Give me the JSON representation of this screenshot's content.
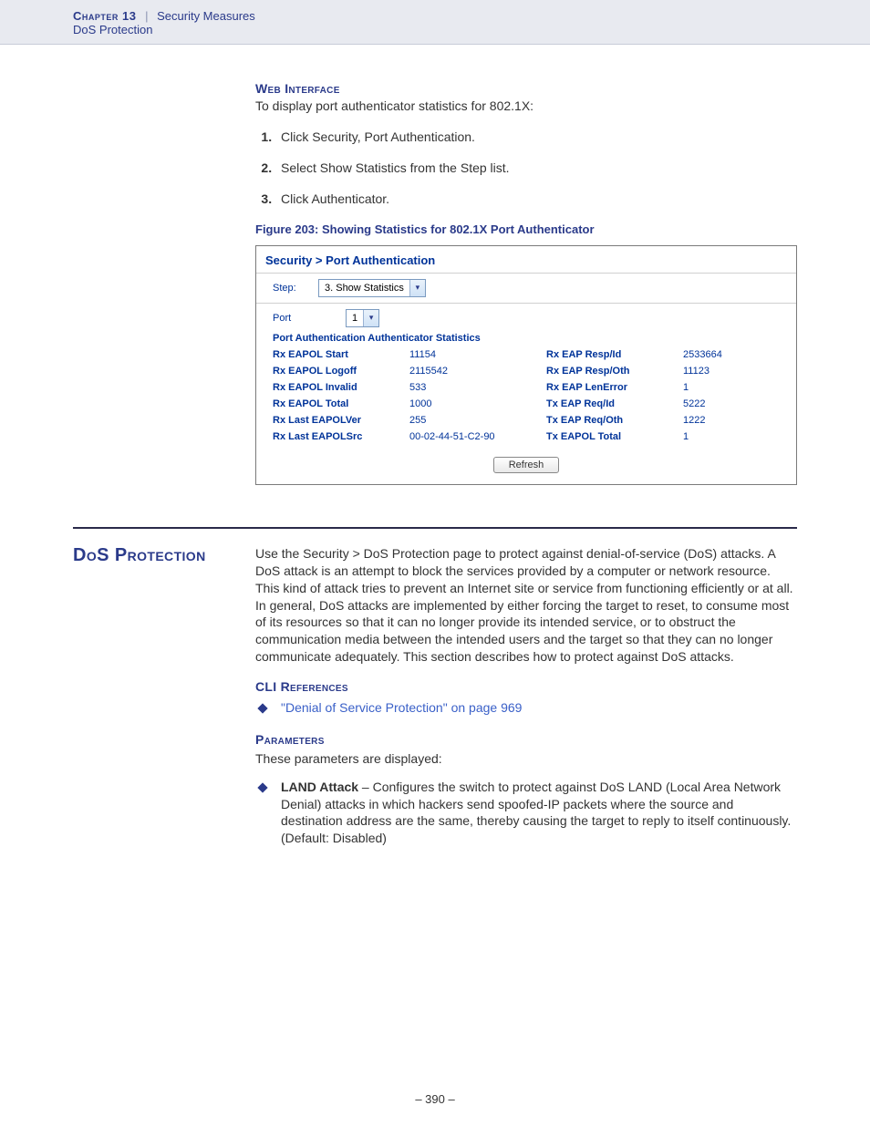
{
  "header": {
    "chapter": "Chapter 13",
    "bar": "|",
    "chapter_title": "Security Measures",
    "subsection": "DoS Protection"
  },
  "web_interface": {
    "heading": "Web Interface",
    "intro": "To display port authenticator statistics for 802.1X:",
    "steps": [
      "Click Security, Port Authentication.",
      "Select Show Statistics from the Step list.",
      "Click Authenticator."
    ],
    "figure_caption": "Figure 203:  Showing Statistics for 802.1X Port Authenticator"
  },
  "screenshot": {
    "breadcrumb": "Security > Port Authentication",
    "step_label": "Step:",
    "step_value": "3. Show Statistics",
    "port_label": "Port",
    "port_value": "1",
    "stats_heading": "Port Authentication Authenticator Statistics",
    "rows": [
      {
        "k1": "Rx EAPOL Start",
        "v1": "11154",
        "k2": "Rx EAP Resp/Id",
        "v2": "2533664"
      },
      {
        "k1": "Rx EAPOL Logoff",
        "v1": "2115542",
        "k2": "Rx EAP Resp/Oth",
        "v2": "11123"
      },
      {
        "k1": "Rx EAPOL Invalid",
        "v1": "533",
        "k2": "Rx EAP LenError",
        "v2": "1"
      },
      {
        "k1": "Rx EAPOL Total",
        "v1": "1000",
        "k2": "Tx EAP Req/Id",
        "v2": "5222"
      },
      {
        "k1": "Rx Last EAPOLVer",
        "v1": "255",
        "k2": "Tx EAP Req/Oth",
        "v2": "1222"
      },
      {
        "k1": "Rx Last EAPOLSrc",
        "v1": "00-02-44-51-C2-90",
        "k2": "Tx EAPOL Total",
        "v2": "1"
      }
    ],
    "refresh": "Refresh"
  },
  "dos": {
    "title": "DoS Protection",
    "body": "Use the Security > DoS Protection page to protect against denial-of-service (DoS) attacks. A DoS attack is an attempt to block the services provided by a computer or network resource. This kind of attack tries to prevent an Internet site or service from functioning efficiently or at all. In general, DoS attacks are implemented by either forcing the target to reset, to consume most of its resources so that it can no longer provide its intended service, or to obstruct the communication media between the intended users and the target so that they can no longer communicate adequately. This section describes how to protect against DoS attacks.",
    "cli_heading": "CLI References",
    "cli_link": "\"Denial of Service Protection\" on page 969",
    "params_heading": "Parameters",
    "params_intro": "These parameters are displayed:",
    "land_name": "LAND Attack",
    "land_desc": " – Configures the switch to protect against DoS LAND (Local Area Network Denial) attacks in which hackers send spoofed-IP packets where the source and destination address are the same, thereby causing the target to reply to itself continuously. (Default: Disabled)"
  },
  "page_number": "–  390  –"
}
